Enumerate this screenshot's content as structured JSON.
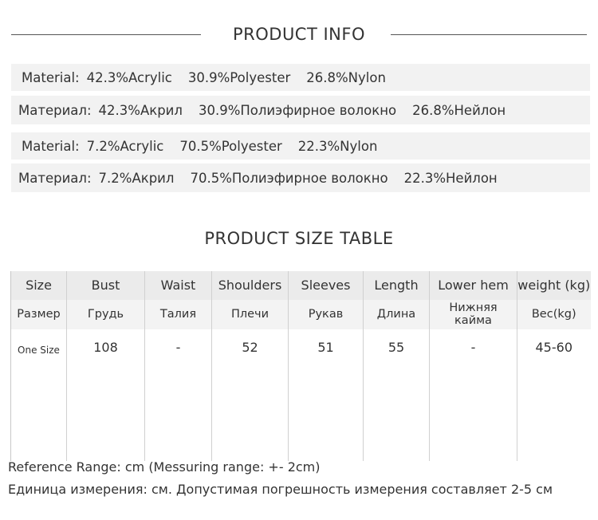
{
  "product_info": {
    "title": "PRODUCT INFO",
    "materials": [
      {
        "label": "Material:",
        "parts": [
          "42.3%Acrylic",
          "30.9%Polyester",
          "26.8%Nylon"
        ]
      },
      {
        "label": "Материал:",
        "parts": [
          "42.3%Акрил",
          "30.9%Полиэфирное волокно",
          "26.8%Нейлон"
        ]
      },
      {
        "label": "Material:",
        "parts": [
          "7.2%Acrylic",
          "70.5%Polyester",
          "22.3%Nylon"
        ]
      },
      {
        "label": "Материал:",
        "parts": [
          "7.2%Акрил",
          "70.5%Полиэфирное волокно",
          "22.3%Нейлон"
        ]
      }
    ]
  },
  "size_table": {
    "title": "PRODUCT SIZE TABLE",
    "headers_en": [
      "Size",
      "Bust",
      "Waist",
      "Shoulders",
      "Sleeves",
      "Length",
      "Lower hem",
      "weight (kg)"
    ],
    "headers_ru": [
      "Размер",
      "Грудь",
      "Талия",
      "Плечи",
      "Рукав",
      "Длина",
      "Нижняя кайма",
      "Вес(kg)"
    ],
    "values": [
      "One Size",
      "108",
      "-",
      "52",
      "51",
      "55",
      "-",
      "45-60"
    ]
  },
  "footer": {
    "line_en": "Reference Range: cm (Messuring range: +- 2cm)",
    "line_ru": "Единица измерения: см. Допустимая погрешность измерения составляет 2-5 см"
  }
}
